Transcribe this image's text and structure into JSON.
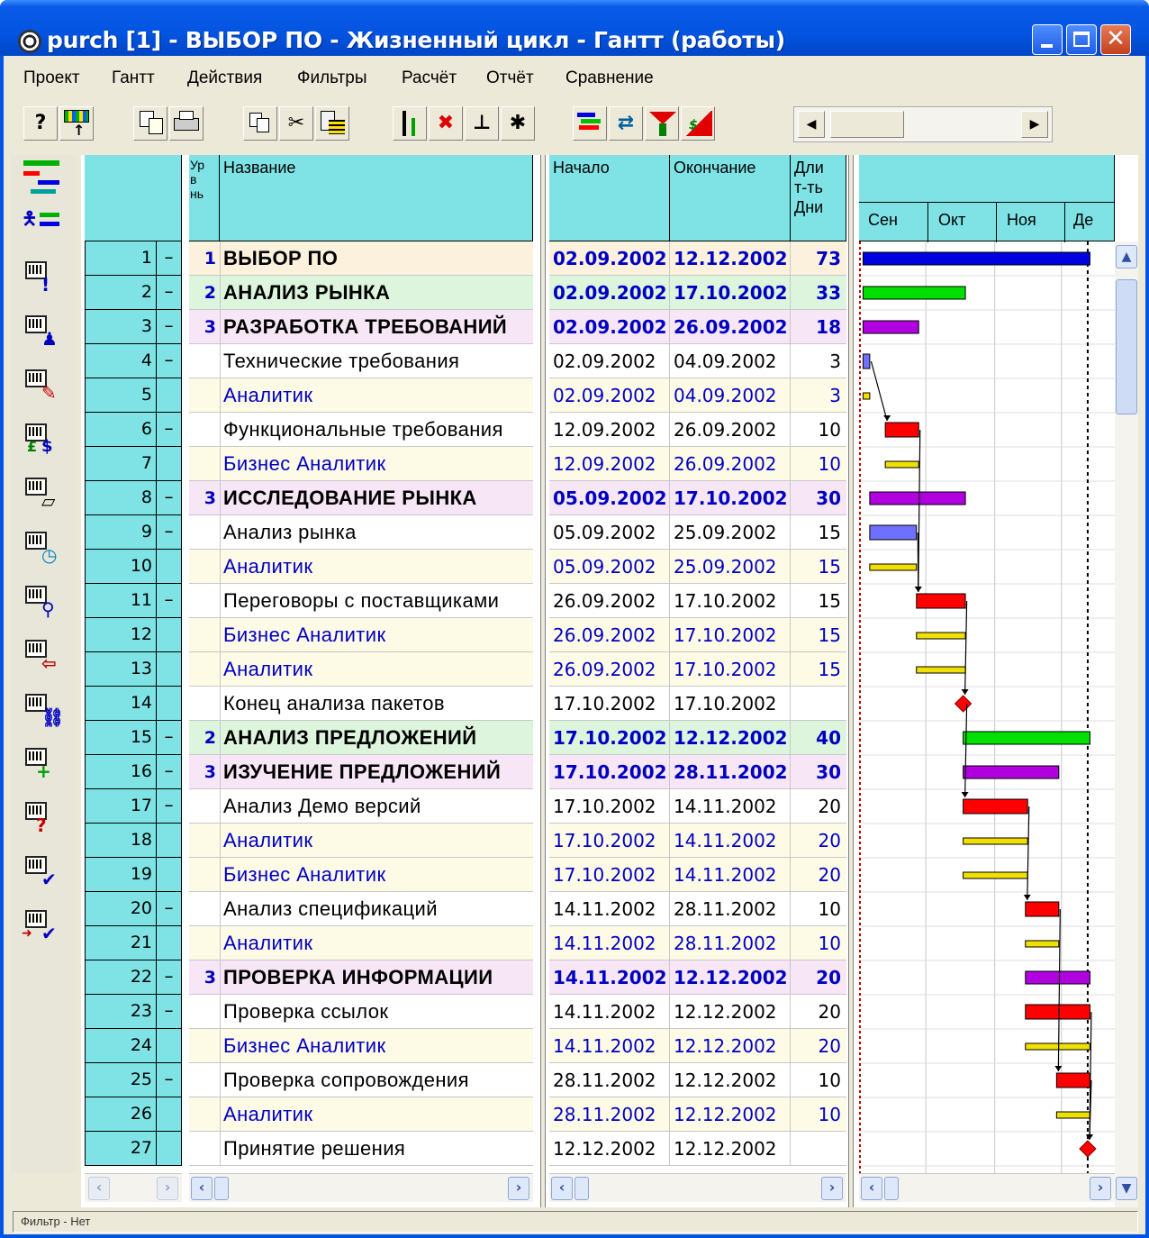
{
  "window": {
    "title": "purch [1] - ВЫБОР ПО - Жизненный цикл - Гантт (работы)"
  },
  "menu": [
    "Проект",
    "Гантт",
    "Действия",
    "Фильтры",
    "Расчёт",
    "Отчёт",
    "Сравнение"
  ],
  "toolbar": {
    "buttons": [
      "help-icon",
      "grid-import-icon",
      "export-icon",
      "print-icon",
      "copy-icon",
      "cut-icon",
      "paste-icon",
      "link-tasks-icon",
      "unlink-tasks-icon",
      "insert-task-icon",
      "delete-link-icon",
      "bar-styles-icon",
      "resource-allocation-icon",
      "filter-icon",
      "cost-curve-icon"
    ]
  },
  "columns": {
    "level": "Ур\nв\nнь",
    "name": "Название",
    "start": "Начало",
    "end": "Окончание",
    "duration": "Дли\nт-ть\nДни",
    "timeline": [
      "Сен",
      "Окт",
      "Ноя",
      "Де"
    ]
  },
  "rows": [
    {
      "n": "1",
      "lvl": "1",
      "name": "ВЫБОР ПО",
      "start": "02.09.2002",
      "end": "12.12.2002",
      "dur": "73",
      "kind": "bold",
      "bg": "#fbf1dc",
      "dash": true
    },
    {
      "n": "2",
      "lvl": "2",
      "name": "АНАЛИЗ РЫНКА",
      "start": "02.09.2002",
      "end": "17.10.2002",
      "dur": "33",
      "kind": "bold",
      "bg": "#ddf5dd",
      "dash": true
    },
    {
      "n": "3",
      "lvl": "3",
      "name": "РАЗРАБОТКА ТРЕБОВАНИЙ",
      "start": "02.09.2002",
      "end": "26.09.2002",
      "dur": "18",
      "kind": "bold",
      "bg": "#f6e6f6",
      "dash": true
    },
    {
      "n": "4",
      "lvl": "",
      "name": "Технические требования",
      "start": "02.09.2002",
      "end": "04.09.2002",
      "dur": "3",
      "kind": "task",
      "bg": "#ffffff",
      "dash": true
    },
    {
      "n": "5",
      "lvl": "",
      "name": "Аналитик",
      "start": "02.09.2002",
      "end": "04.09.2002",
      "dur": "3",
      "kind": "resource",
      "bg": "#fdfae6",
      "dash": false
    },
    {
      "n": "6",
      "lvl": "",
      "name": "Функциональные требования",
      "start": "12.09.2002",
      "end": "26.09.2002",
      "dur": "10",
      "kind": "task",
      "bg": "#ffffff",
      "dash": true
    },
    {
      "n": "7",
      "lvl": "",
      "name": "Бизнес Аналитик",
      "start": "12.09.2002",
      "end": "26.09.2002",
      "dur": "10",
      "kind": "resource",
      "bg": "#fdfae6",
      "dash": false
    },
    {
      "n": "8",
      "lvl": "3",
      "name": "ИССЛЕДОВАНИЕ РЫНКА",
      "start": "05.09.2002",
      "end": "17.10.2002",
      "dur": "30",
      "kind": "bold",
      "bg": "#f6e6f6",
      "dash": true
    },
    {
      "n": "9",
      "lvl": "",
      "name": "Анализ рынка",
      "start": "05.09.2002",
      "end": "25.09.2002",
      "dur": "15",
      "kind": "task",
      "bg": "#ffffff",
      "dash": true
    },
    {
      "n": "10",
      "lvl": "",
      "name": "Аналитик",
      "start": "05.09.2002",
      "end": "25.09.2002",
      "dur": "15",
      "kind": "resource",
      "bg": "#fdfae6",
      "dash": false
    },
    {
      "n": "11",
      "lvl": "",
      "name": "Переговоры с поставщиками",
      "start": "26.09.2002",
      "end": "17.10.2002",
      "dur": "15",
      "kind": "task",
      "bg": "#ffffff",
      "dash": true
    },
    {
      "n": "12",
      "lvl": "",
      "name": "Бизнес Аналитик",
      "start": "26.09.2002",
      "end": "17.10.2002",
      "dur": "15",
      "kind": "resource",
      "bg": "#fdfae6",
      "dash": false
    },
    {
      "n": "13",
      "lvl": "",
      "name": "Аналитик",
      "start": "26.09.2002",
      "end": "17.10.2002",
      "dur": "15",
      "kind": "resource",
      "bg": "#fdfae6",
      "dash": false
    },
    {
      "n": "14",
      "lvl": "",
      "name": "Конец анализа пакетов",
      "start": "17.10.2002",
      "end": "17.10.2002",
      "dur": "",
      "kind": "task",
      "bg": "#ffffff",
      "dash": false
    },
    {
      "n": "15",
      "lvl": "2",
      "name": "АНАЛИЗ ПРЕДЛОЖЕНИЙ",
      "start": "17.10.2002",
      "end": "12.12.2002",
      "dur": "40",
      "kind": "bold",
      "bg": "#ddf5dd",
      "dash": true
    },
    {
      "n": "16",
      "lvl": "3",
      "name": "ИЗУЧЕНИЕ ПРЕДЛОЖЕНИЙ",
      "start": "17.10.2002",
      "end": "28.11.2002",
      "dur": "30",
      "kind": "bold",
      "bg": "#f6e6f6",
      "dash": true
    },
    {
      "n": "17",
      "lvl": "",
      "name": "Анализ Демо версий",
      "start": "17.10.2002",
      "end": "14.11.2002",
      "dur": "20",
      "kind": "task",
      "bg": "#ffffff",
      "dash": true
    },
    {
      "n": "18",
      "lvl": "",
      "name": "Аналитик",
      "start": "17.10.2002",
      "end": "14.11.2002",
      "dur": "20",
      "kind": "resource",
      "bg": "#fdfae6",
      "dash": false
    },
    {
      "n": "19",
      "lvl": "",
      "name": "Бизнес Аналитик",
      "start": "17.10.2002",
      "end": "14.11.2002",
      "dur": "20",
      "kind": "resource",
      "bg": "#fdfae6",
      "dash": false
    },
    {
      "n": "20",
      "lvl": "",
      "name": "Анализ спецификаций",
      "start": "14.11.2002",
      "end": "28.11.2002",
      "dur": "10",
      "kind": "task",
      "bg": "#ffffff",
      "dash": true
    },
    {
      "n": "21",
      "lvl": "",
      "name": "Аналитик",
      "start": "14.11.2002",
      "end": "28.11.2002",
      "dur": "10",
      "kind": "resource",
      "bg": "#fdfae6",
      "dash": false
    },
    {
      "n": "22",
      "lvl": "3",
      "name": "ПРОВЕРКА ИНФОРМАЦИИ",
      "start": "14.11.2002",
      "end": "12.12.2002",
      "dur": "20",
      "kind": "bold",
      "bg": "#f6e6f6",
      "dash": true
    },
    {
      "n": "23",
      "lvl": "",
      "name": "Проверка ссылок",
      "start": "14.11.2002",
      "end": "12.12.2002",
      "dur": "20",
      "kind": "task",
      "bg": "#ffffff",
      "dash": true
    },
    {
      "n": "24",
      "lvl": "",
      "name": "Бизнес Аналитик",
      "start": "14.11.2002",
      "end": "12.12.2002",
      "dur": "20",
      "kind": "resource",
      "bg": "#fdfae6",
      "dash": false
    },
    {
      "n": "25",
      "lvl": "",
      "name": "Проверка сопровождения",
      "start": "28.11.2002",
      "end": "12.12.2002",
      "dur": "10",
      "kind": "task",
      "bg": "#ffffff",
      "dash": true
    },
    {
      "n": "26",
      "lvl": "",
      "name": "Аналитик",
      "start": "28.11.2002",
      "end": "12.12.2002",
      "dur": "10",
      "kind": "resource",
      "bg": "#fdfae6",
      "dash": false
    },
    {
      "n": "27",
      "lvl": "",
      "name": "Принятие решения",
      "start": "12.12.2002",
      "end": "12.12.2002",
      "dur": "",
      "kind": "task",
      "bg": "#ffffff",
      "dash": false
    }
  ],
  "gantt_bars": [
    {
      "row": 0,
      "start": "02.09.2002",
      "end": "12.12.2002",
      "color": "#0000e0",
      "type": "summary"
    },
    {
      "row": 1,
      "start": "02.09.2002",
      "end": "17.10.2002",
      "color": "#00e000",
      "type": "summary"
    },
    {
      "row": 2,
      "start": "02.09.2002",
      "end": "26.09.2002",
      "color": "#b000e0",
      "type": "summary"
    },
    {
      "row": 3,
      "start": "02.09.2002",
      "end": "04.09.2002",
      "color": "#7070ff",
      "type": "task"
    },
    {
      "row": 4,
      "start": "02.09.2002",
      "end": "04.09.2002",
      "color": "#f0e000",
      "type": "resource"
    },
    {
      "row": 5,
      "start": "12.09.2002",
      "end": "26.09.2002",
      "color": "#ff0000",
      "type": "task"
    },
    {
      "row": 6,
      "start": "12.09.2002",
      "end": "26.09.2002",
      "color": "#f0e000",
      "type": "resource"
    },
    {
      "row": 7,
      "start": "05.09.2002",
      "end": "17.10.2002",
      "color": "#b000e0",
      "type": "summary"
    },
    {
      "row": 8,
      "start": "05.09.2002",
      "end": "25.09.2002",
      "color": "#7070ff",
      "type": "task"
    },
    {
      "row": 9,
      "start": "05.09.2002",
      "end": "25.09.2002",
      "color": "#f0e000",
      "type": "resource"
    },
    {
      "row": 10,
      "start": "26.09.2002",
      "end": "17.10.2002",
      "color": "#ff0000",
      "type": "task"
    },
    {
      "row": 11,
      "start": "26.09.2002",
      "end": "17.10.2002",
      "color": "#f0e000",
      "type": "resource"
    },
    {
      "row": 12,
      "start": "26.09.2002",
      "end": "17.10.2002",
      "color": "#f0e000",
      "type": "resource"
    },
    {
      "row": 13,
      "start": "17.10.2002",
      "end": "17.10.2002",
      "color": "#ff0000",
      "type": "milestone"
    },
    {
      "row": 14,
      "start": "17.10.2002",
      "end": "12.12.2002",
      "color": "#00e000",
      "type": "summary"
    },
    {
      "row": 15,
      "start": "17.10.2002",
      "end": "28.11.2002",
      "color": "#b000e0",
      "type": "summary"
    },
    {
      "row": 16,
      "start": "17.10.2002",
      "end": "14.11.2002",
      "color": "#ff0000",
      "type": "task"
    },
    {
      "row": 17,
      "start": "17.10.2002",
      "end": "14.11.2002",
      "color": "#f0e000",
      "type": "resource"
    },
    {
      "row": 18,
      "start": "17.10.2002",
      "end": "14.11.2002",
      "color": "#f0e000",
      "type": "resource"
    },
    {
      "row": 19,
      "start": "14.11.2002",
      "end": "28.11.2002",
      "color": "#ff0000",
      "type": "task"
    },
    {
      "row": 20,
      "start": "14.11.2002",
      "end": "28.11.2002",
      "color": "#f0e000",
      "type": "resource"
    },
    {
      "row": 21,
      "start": "14.11.2002",
      "end": "12.12.2002",
      "color": "#b000e0",
      "type": "summary"
    },
    {
      "row": 22,
      "start": "14.11.2002",
      "end": "12.12.2002",
      "color": "#ff0000",
      "type": "task"
    },
    {
      "row": 23,
      "start": "14.11.2002",
      "end": "12.12.2002",
      "color": "#f0e000",
      "type": "resource"
    },
    {
      "row": 24,
      "start": "28.11.2002",
      "end": "12.12.2002",
      "color": "#ff0000",
      "type": "task"
    },
    {
      "row": 25,
      "start": "28.11.2002",
      "end": "12.12.2002",
      "color": "#f0e000",
      "type": "resource"
    },
    {
      "row": 26,
      "start": "12.12.2002",
      "end": "12.12.2002",
      "color": "#ff0000",
      "type": "milestone"
    }
  ],
  "status": "Фильтр - Нет"
}
